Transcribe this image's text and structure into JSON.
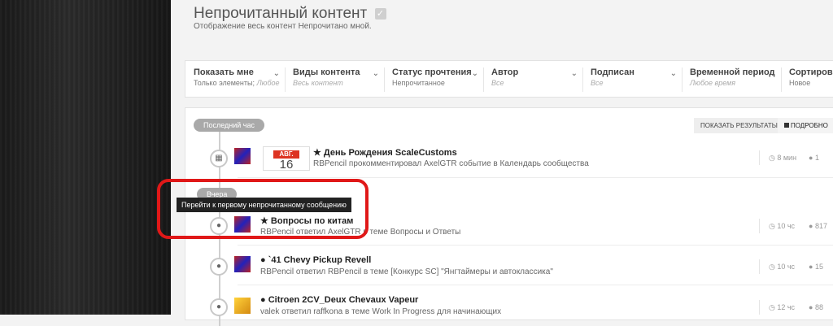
{
  "header": {
    "title": "Непрочитанный контент",
    "subtitle": "Отображение весь контент Непрочитано мной."
  },
  "filters": [
    {
      "label": "Показать мне",
      "value": "Только элементы;",
      "value_muted": "Любое"
    },
    {
      "label": "Виды контента",
      "value": "",
      "value_muted": "Весь контент"
    },
    {
      "label": "Статус прочтения",
      "value": "Непрочитанное",
      "value_muted": ""
    },
    {
      "label": "Автор",
      "value": "",
      "value_muted": "Все"
    },
    {
      "label": "Подписан",
      "value": "",
      "value_muted": "Все"
    },
    {
      "label": "Временной период",
      "value": "",
      "value_muted": "Любое время"
    },
    {
      "label": "Сортиров",
      "value": "Новое",
      "value_muted": ""
    }
  ],
  "toolbar": {
    "show_results": "ПОКАЗАТЬ РЕЗУЛЬТАТЫ",
    "detailed": "ПОДРОБНО"
  },
  "timeline": {
    "last_hour": "Последний час",
    "yesterday": "Вчера"
  },
  "tooltip": "Перейти к первому непрочитанному сообщению",
  "items": [
    {
      "title": "День Рождения ScaleCustoms",
      "subtitle": "RBPencil прокомментировал AxelGTR событие в Календарь сообщества",
      "date_month": "АВГ.",
      "date_day": "16",
      "time": "8 мин",
      "count": "1"
    },
    {
      "title": "Вопросы по китам",
      "subtitle": "RBPencil ответил AxelGTR в теме Вопросы и Ответы",
      "time": "10 чс",
      "count": "817"
    },
    {
      "title": "`41 Chevy Pickup Revell",
      "subtitle": "RBPencil ответил RBPencil в теме [Конкурс SC] \"Янгтаймеры и автоклассика\"",
      "time": "10 чс",
      "count": "15"
    },
    {
      "title": "Citroen 2CV_Deux Chevaux Vapeur",
      "subtitle": "valek ответил raffkona в теме Work In Progress для начинающих",
      "time": "12 чс",
      "count": "88"
    }
  ],
  "colors": {
    "highlight": "#e01818",
    "pill": "#a9a9a9"
  }
}
